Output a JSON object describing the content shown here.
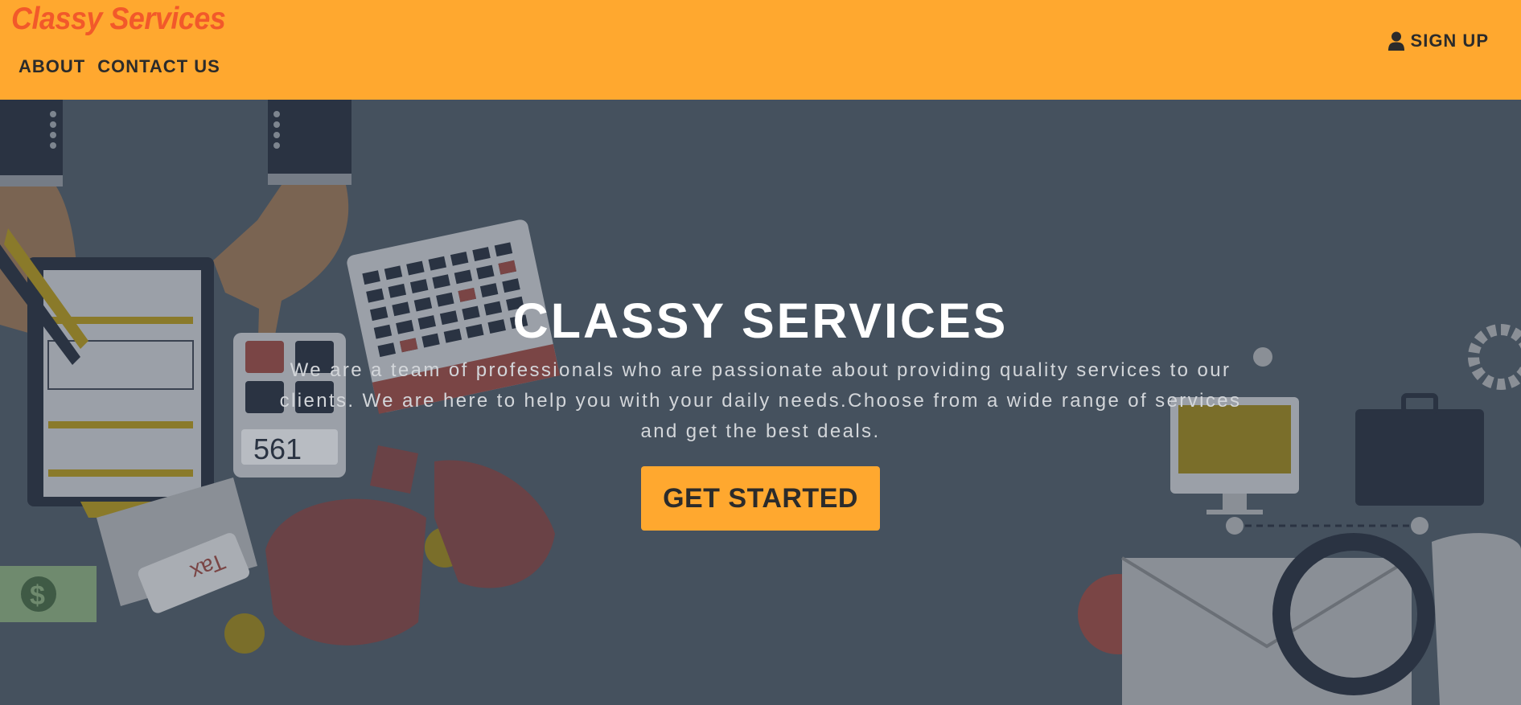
{
  "header": {
    "brand": "Classy Services",
    "nav": [
      {
        "label": "ABOUT"
      },
      {
        "label": "CONTACT US"
      }
    ],
    "signup_label": "SIGN UP",
    "signup_icon": "user-icon"
  },
  "hero": {
    "title": "CLASSY SERVICES",
    "description": "We are a team of professionals who are passionate about providing quality services to our clients. We are here to help you with your daily needs.Choose from a wide range of services and get the best deals.",
    "cta_label": "GET STARTED",
    "calculator_display": "561",
    "tag_text": "Tax",
    "currency_symbol": "$"
  },
  "colors": {
    "accent": "#ffa82f",
    "brand": "#f2592a",
    "overlay": "#45515e",
    "text_dark": "#2b2b2b"
  }
}
